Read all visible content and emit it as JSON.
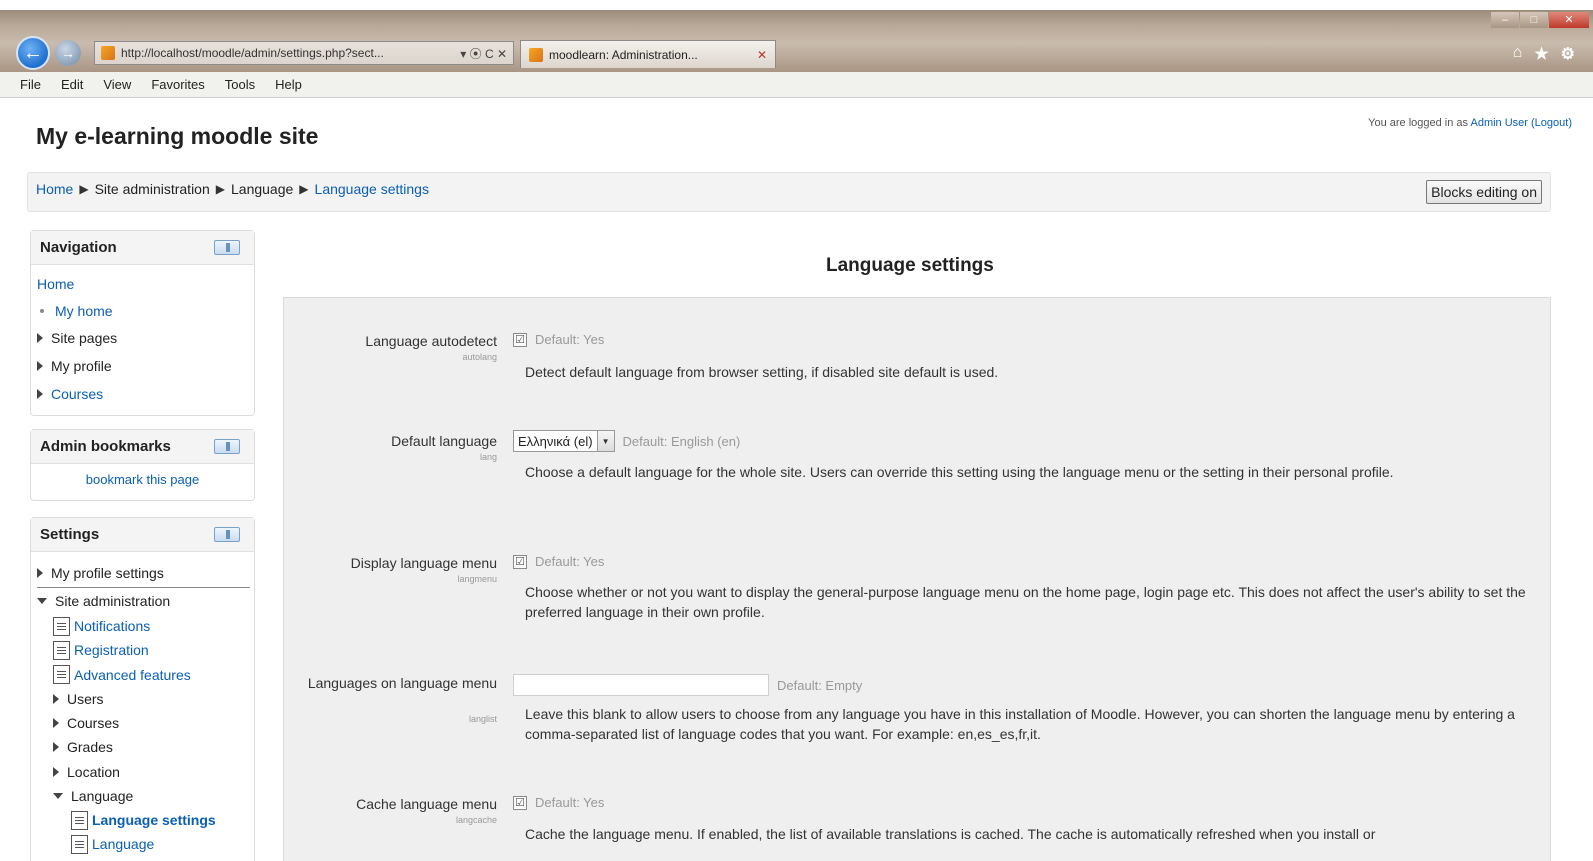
{
  "browser": {
    "url": "http://localhost/moodle/admin/settings.php?sect...",
    "tab_title": "moodlearn: Administration...",
    "win_min": "–",
    "win_max": "□",
    "win_close": "✕",
    "address_tools": "▾ ⦿ C ✕",
    "chrome_icons": [
      "⌂",
      "★",
      "⚙"
    ]
  },
  "menubar": [
    "File",
    "Edit",
    "View",
    "Favorites",
    "Tools",
    "Help"
  ],
  "site": {
    "title": "My e-learning moodle site",
    "login_prefix": "You are logged in as ",
    "login_user": "Admin User",
    "login_logout": "(Logout)"
  },
  "breadcrumb": {
    "items": [
      "Home",
      "Site administration",
      "Language",
      "Language settings"
    ],
    "separator": "▶"
  },
  "blocks_button": "Blocks editing on",
  "navigation": {
    "title": "Navigation",
    "home": "Home",
    "my_home": "My home",
    "site_pages": "Site pages",
    "my_profile": "My profile",
    "courses": "Courses"
  },
  "admin_bookmarks": {
    "title": "Admin bookmarks",
    "bookmark": "bookmark this page"
  },
  "settings_block": {
    "title": "Settings",
    "my_profile_settings": "My profile settings",
    "site_administration": "Site administration",
    "notifications": "Notifications",
    "registration": "Registration",
    "advanced_features": "Advanced features",
    "users": "Users",
    "courses": "Courses",
    "grades": "Grades",
    "location": "Location",
    "language": "Language",
    "language_settings": "Language settings",
    "language_more": "Language"
  },
  "main": {
    "title": "Language settings",
    "settings": [
      {
        "label": "Language autodetect",
        "key": "autolang",
        "checked": true,
        "default": "Default: Yes",
        "description": "Detect default language from browser setting, if disabled site default is used."
      },
      {
        "label": "Default language",
        "key": "lang",
        "select_value": "Ελληνικά (el)",
        "default": "Default: English (en)",
        "description": "Choose a default language for the whole site. Users can override this setting using the language menu or the setting in their personal profile."
      },
      {
        "label": "Display language menu",
        "key": "langmenu",
        "checked": true,
        "default": "Default: Yes",
        "description": "Choose whether or not you want to display the general-purpose language menu on the home page, login page etc. This does not affect the user's ability to set the preferred language in their own profile."
      },
      {
        "label": "Languages on language menu",
        "key": "langlist",
        "input_value": "",
        "default": "Default: Empty",
        "description": "Leave this blank to allow users to choose from any language you have in this installation of Moodle. However, you can shorten the language menu by entering a comma-separated list of language codes that you want. For example: en,es_es,fr,it."
      },
      {
        "label": "Cache language menu",
        "key": "langcache",
        "checked": true,
        "default": "Default: Yes",
        "description": "Cache the language menu. If enabled, the list of available translations is cached. The cache is automatically refreshed when you install or"
      }
    ]
  },
  "glyphs": {
    "check": "☑",
    "select_arrow": "▼"
  }
}
